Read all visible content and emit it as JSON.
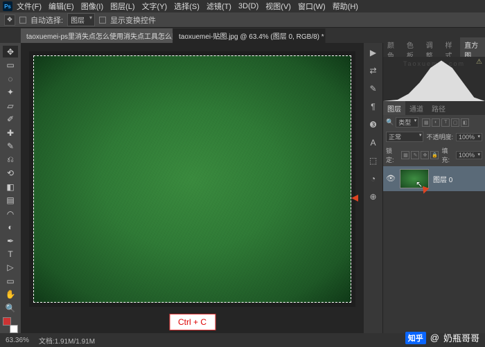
{
  "menu": [
    "文件(F)",
    "编辑(E)",
    "图像(I)",
    "图层(L)",
    "文字(Y)",
    "选择(S)",
    "滤镜(T)",
    "3D(D)",
    "视图(V)",
    "窗口(W)",
    "帮助(H)"
  ],
  "optbar": {
    "auto_select": "自动选择:",
    "target": "图层",
    "show_controls": "显示变换控件"
  },
  "tabs": [
    {
      "label": "taoxuemei-ps里消失点怎么使用消失点工具怎么贴图.psd",
      "close": "×"
    },
    {
      "label": "taoxuemei-贴图.jpg @ 63.4% (图层 0, RGB/8) *",
      "close": "×"
    }
  ],
  "hint": "Ctrl + C",
  "tools": [
    "↕",
    "▭",
    "◌",
    "✥",
    "▱",
    "✂",
    "✎",
    "✚",
    "⌕",
    "◐",
    "✦",
    "◉",
    "▤",
    "⟲",
    "✐",
    "✎",
    "╲",
    "▭",
    "✋",
    "🔍"
  ],
  "right_strip": [
    "▶",
    "⇄",
    "✎",
    "¶",
    "❸",
    "A",
    "⬚",
    "◔",
    "⊕"
  ],
  "top_panel": {
    "tabs": [
      "颜色",
      "色板",
      "调整",
      "样式",
      "直方图"
    ],
    "active": 4,
    "watermark": "Taoxuemei.com"
  },
  "layers_panel": {
    "tabs": [
      "图层",
      "通道",
      "路径"
    ],
    "kind": "类型",
    "blend": "正常",
    "opacity_label": "不透明度:",
    "opacity": "100%",
    "lock_label": "锁定:",
    "fill_label": "填充:",
    "fill": "100%",
    "layer_name": "图层 0"
  },
  "status": {
    "zoom": "63.36%",
    "doc": "文档:1.91M/1.91M"
  },
  "zhihu": {
    "logo": "知乎",
    "at": "@",
    "user": "奶瓶哥哥"
  }
}
